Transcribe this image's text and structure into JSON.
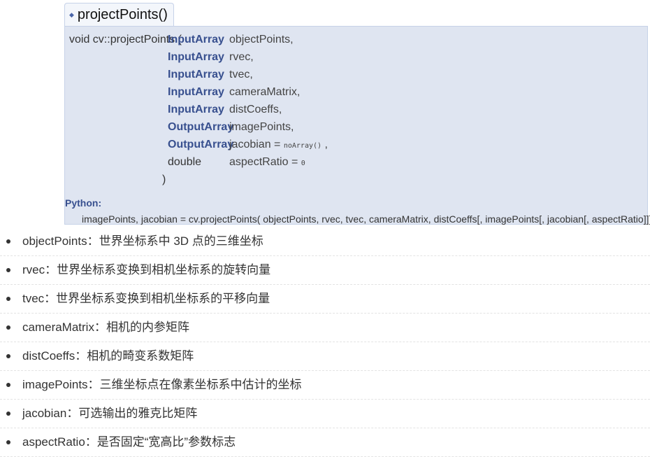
{
  "function_title": "projectPoints()",
  "prototype": {
    "lead": "void cv::projectPoints (",
    "params": [
      {
        "type": "InputArray",
        "name": "objectPoints,",
        "default_label": "",
        "default_value": ""
      },
      {
        "type": "InputArray",
        "name": "rvec,",
        "default_label": "",
        "default_value": ""
      },
      {
        "type": "InputArray",
        "name": "tvec,",
        "default_label": "",
        "default_value": ""
      },
      {
        "type": "InputArray",
        "name": "cameraMatrix,",
        "default_label": "",
        "default_value": ""
      },
      {
        "type": "InputArray",
        "name": "distCoeffs,",
        "default_label": "",
        "default_value": ""
      },
      {
        "type": "OutputArray",
        "name": "imagePoints,",
        "default_label": "",
        "default_value": ""
      },
      {
        "type": "OutputArray",
        "name": "jacobian",
        "default_label": " = ",
        "default_value": "noArray()",
        "tail": " ,"
      },
      {
        "type": "double",
        "name": "aspectRatio",
        "default_label": " = ",
        "default_value": "0",
        "tail": ""
      }
    ],
    "close": ")"
  },
  "python": {
    "label": "Python:",
    "signature": "imagePoints, jacobian = cv.projectPoints( objectPoints, rvec, tvec, cameraMatrix, distCoeffs[, imagePoints[, jacobian[, aspectRatio]]] )"
  },
  "descriptions": [
    "objectPoints：世界坐标系中 3D 点的三维坐标",
    "rvec：世界坐标系变换到相机坐标系的旋转向量",
    "tvec：世界坐标系变换到相机坐标系的平移向量",
    "cameraMatrix：相机的内参矩阵",
    "distCoeffs：相机的畸变系数矩阵",
    "imagePoints：三维坐标点在像素坐标系中估计的坐标",
    "jacobian：可选输出的雅克比矩阵",
    "aspectRatio：是否固定“宽高比”参数标志"
  ]
}
